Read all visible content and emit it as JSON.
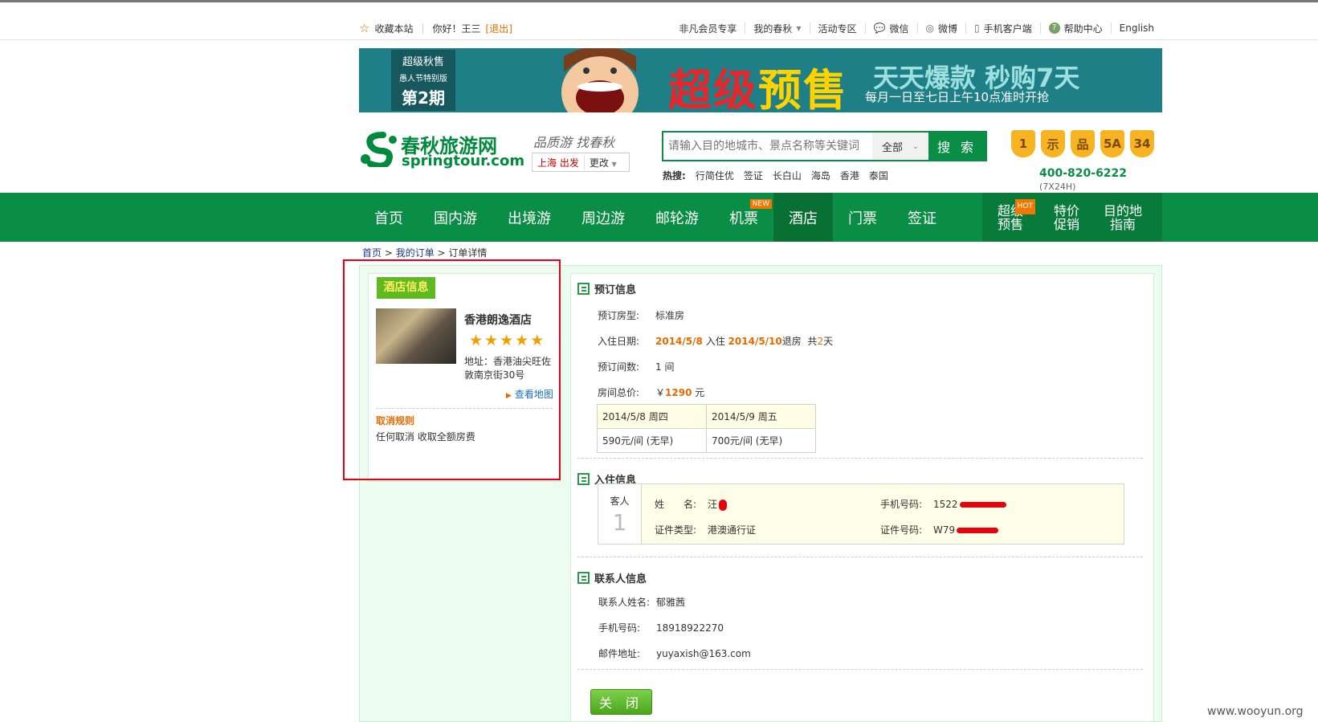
{
  "topbar": {
    "favorite": "收藏本站",
    "greeting": "你好！王三",
    "logout": "[退出]",
    "links": [
      "非凡会员专享",
      "我的春秋",
      "活动专区",
      "微信",
      "微博",
      "手机客户端",
      "帮助中心",
      "English"
    ]
  },
  "banner": {
    "badge_line1": "超级秋售",
    "badge_line2": "愚人节特别版",
    "badge_line3": "第2期",
    "title_a": "超级",
    "title_b": "预售",
    "title_right": "天天爆款 秒购7天",
    "subtitle": "每月一日至七日上午10点准时开抢"
  },
  "header": {
    "logo_cn": "春秋旅游网",
    "logo_en": "springtour.com",
    "slogan": "品质游 找春秋",
    "city": "上海 出发",
    "city_change": "更改",
    "search_placeholder": "请输入目的地城市、景点名称等关键词",
    "search_scope": "全部",
    "search_button": "搜 索",
    "hot_label": "热搜:",
    "hot_terms": [
      "行简住优",
      "签证",
      "长白山",
      "海岛",
      "香港",
      "泰国"
    ],
    "badges": [
      "1",
      "示",
      "品",
      "5A",
      "34"
    ],
    "phone": "400-820-6222",
    "phone_note": "(7X24H)"
  },
  "nav": {
    "items": [
      "首页",
      "国内游",
      "出境游",
      "周边游",
      "邮轮游",
      "机票",
      "酒店",
      "门票",
      "签证"
    ],
    "new_tag": "NEW",
    "active": "酒店",
    "group": [
      "超级预售",
      "特价促销",
      "目的地指南"
    ],
    "hot_tag": "HOT"
  },
  "breadcrumb": {
    "home": "首页",
    "orders": "我的订单",
    "current": "订单详情"
  },
  "hotel": {
    "tag": "酒店信息",
    "name": "香港朗逸酒店",
    "stars": 5,
    "address": "地址：香港油尖旺佐敦南京街30号",
    "map_link": "查看地图",
    "cancel_title": "取消规则",
    "cancel_text": "任何取消 收取全额房费"
  },
  "booking": {
    "title": "预订信息",
    "room_type_label": "预订房型:",
    "room_type": "标准房",
    "date_label": "入住日期:",
    "checkin": "2014/5/8",
    "checkin_suffix": "入住",
    "checkout": "2014/5/10",
    "checkout_suffix": "退房",
    "total_prefix": "共",
    "nights": "2",
    "nights_suffix": "天",
    "rooms_label": "预订间数:",
    "rooms": "1 间",
    "price_label": "房间总价:",
    "price_currency": "￥",
    "price": "1290",
    "price_unit": "元",
    "price_table": [
      {
        "date": "2014/5/8 周四",
        "price": "590元/间 (无早)"
      },
      {
        "date": "2014/5/9 周五",
        "price": "700元/间 (无早)"
      }
    ]
  },
  "guest": {
    "title": "入住信息",
    "label": "客人",
    "index": "1",
    "name_label": "姓　　名:",
    "name": "汪",
    "phone_label": "手机号码:",
    "phone": "1522",
    "id_type_label": "证件类型:",
    "id_type": "港澳通行证",
    "id_no_label": "证件号码:",
    "id_no": "W79"
  },
  "contact": {
    "title": "联系人信息",
    "name_label": "联系人姓名:",
    "name": "郁雅茜",
    "phone_label": "手机号码:",
    "phone": "18918922270",
    "email_label": "邮件地址:",
    "email": "yuyaxish@163.com"
  },
  "close_button": "关 闭",
  "watermark": "www.wooyun.org",
  "colors": {
    "brand_green": "#0a8d45",
    "accent_orange": "#e66a00",
    "highlight_red": "#e60012"
  }
}
